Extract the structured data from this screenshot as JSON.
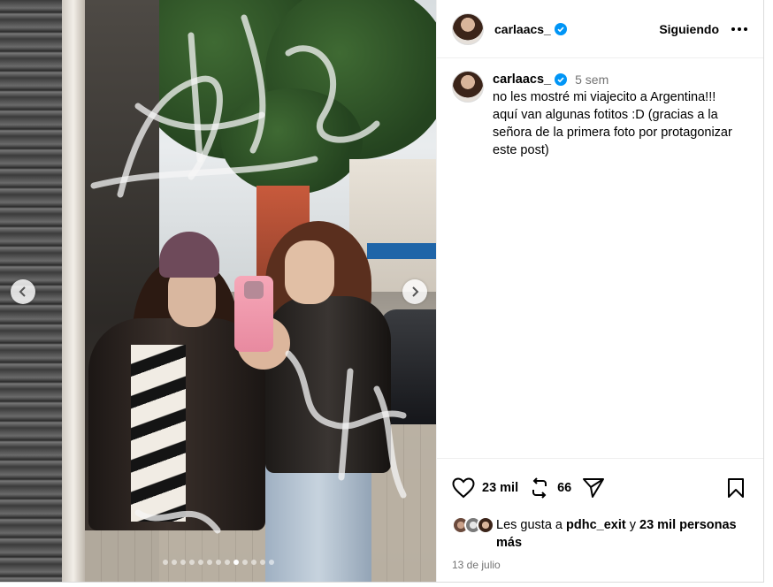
{
  "account": {
    "username": "carlaacs_",
    "verified": true,
    "follow_state": "Siguiendo"
  },
  "caption": {
    "username": "carlaacs_",
    "time_ago": "5 sem",
    "text": "no les mostré mi viajecito a Argentina!!!\naquí van algunas fotitos :D (gracias a la señora de la primera foto por protagonizar este post)"
  },
  "actions": {
    "likes_count": "23 mil",
    "reposts_count": "66"
  },
  "likes": {
    "prefix": "Les gusta a ",
    "user": "pdhc_exit",
    "joiner": " y ",
    "others": "23 mil personas más"
  },
  "post_date": "13 de julio",
  "carousel": {
    "total": 13,
    "active_index": 8
  },
  "colors": {
    "verified_blue": "#0095f6",
    "secondary_text": "#737373",
    "border": "#dbdbdb"
  },
  "icons": [
    "chevron-left-icon",
    "chevron-right-icon",
    "verified-badge-icon",
    "more-options-icon",
    "heart-icon",
    "repost-icon",
    "share-icon",
    "bookmark-icon"
  ]
}
